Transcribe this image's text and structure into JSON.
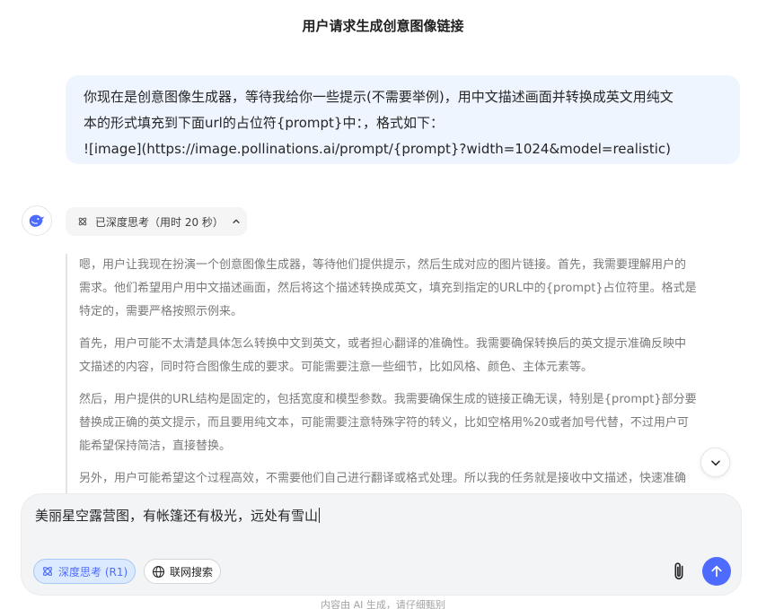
{
  "header": {
    "title": "用户请求生成创意图像链接"
  },
  "user_message": {
    "lines": [
      "你现在是创意图像生成器，等待我给你一些提示(不需要举例)，用中文描述画面并转换成英文用纯文",
      "本的形式填充到下面url的占位符{prompt}中：，格式如下：",
      "![image](https://image.pollinations.ai/prompt/{prompt}?width=1024&model=realistic)"
    ]
  },
  "assistant": {
    "avatar_icon": "whale-logo-icon",
    "think_chip": {
      "label": "已深度思考（用时 20 秒）",
      "icon": "atom-icon",
      "chevron": "chevron-up-icon"
    },
    "thinking_paragraphs": [
      [
        "嗯，用户让我现在扮演一个创意图像生成器，等待他们提供提示，然后生成对应的图片链接。首先，我需要理解用户的",
        "需求。他们希望用户用中文描述画面，然后将这个描述转换成英文，填充到指定的URL中的{prompt}占位符里。格式是",
        "特定的，需要严格按照示例来。"
      ],
      [
        "首先，用户可能不太清楚具体怎么转换中文到英文，或者担心翻译的准确性。我需要确保转换后的英文提示准确反映中",
        "文描述的内容，同时符合图像生成的要求。可能需要注意一些细节，比如风格、颜色、主体元素等。"
      ],
      [
        "然后，用户提供的URL结构是固定的，包括宽度和模型参数。我需要确保生成的链接正确无误，特别是{prompt}部分要",
        "替换成正确的英文提示，而且要用纯文本，可能需要注意特殊字符的转义，比如空格用%20或者加号代替，不过用户可",
        "能希望保持简洁，直接替换。"
      ],
      [
        "另外，用户可能希望这个过程高效，不需要他们自己进行翻译或格式处理。所以我的任务就是接收中文描述，快速准确"
      ]
    ]
  },
  "composer": {
    "input_value": "美丽星空露营图，有帐篷还有极光，远处有雪山",
    "deep_think_label": "深度思考 (R1)",
    "web_search_label": "联网搜索",
    "attach_icon": "paperclip-icon",
    "send_icon": "arrow-up-icon"
  },
  "footer": {
    "note": "内容由 AI 生成，请仔细甄别"
  },
  "colors": {
    "accent": "#4d6bfe",
    "bubble": "#eef5ff",
    "composer_bg": "#f3f4f6"
  }
}
